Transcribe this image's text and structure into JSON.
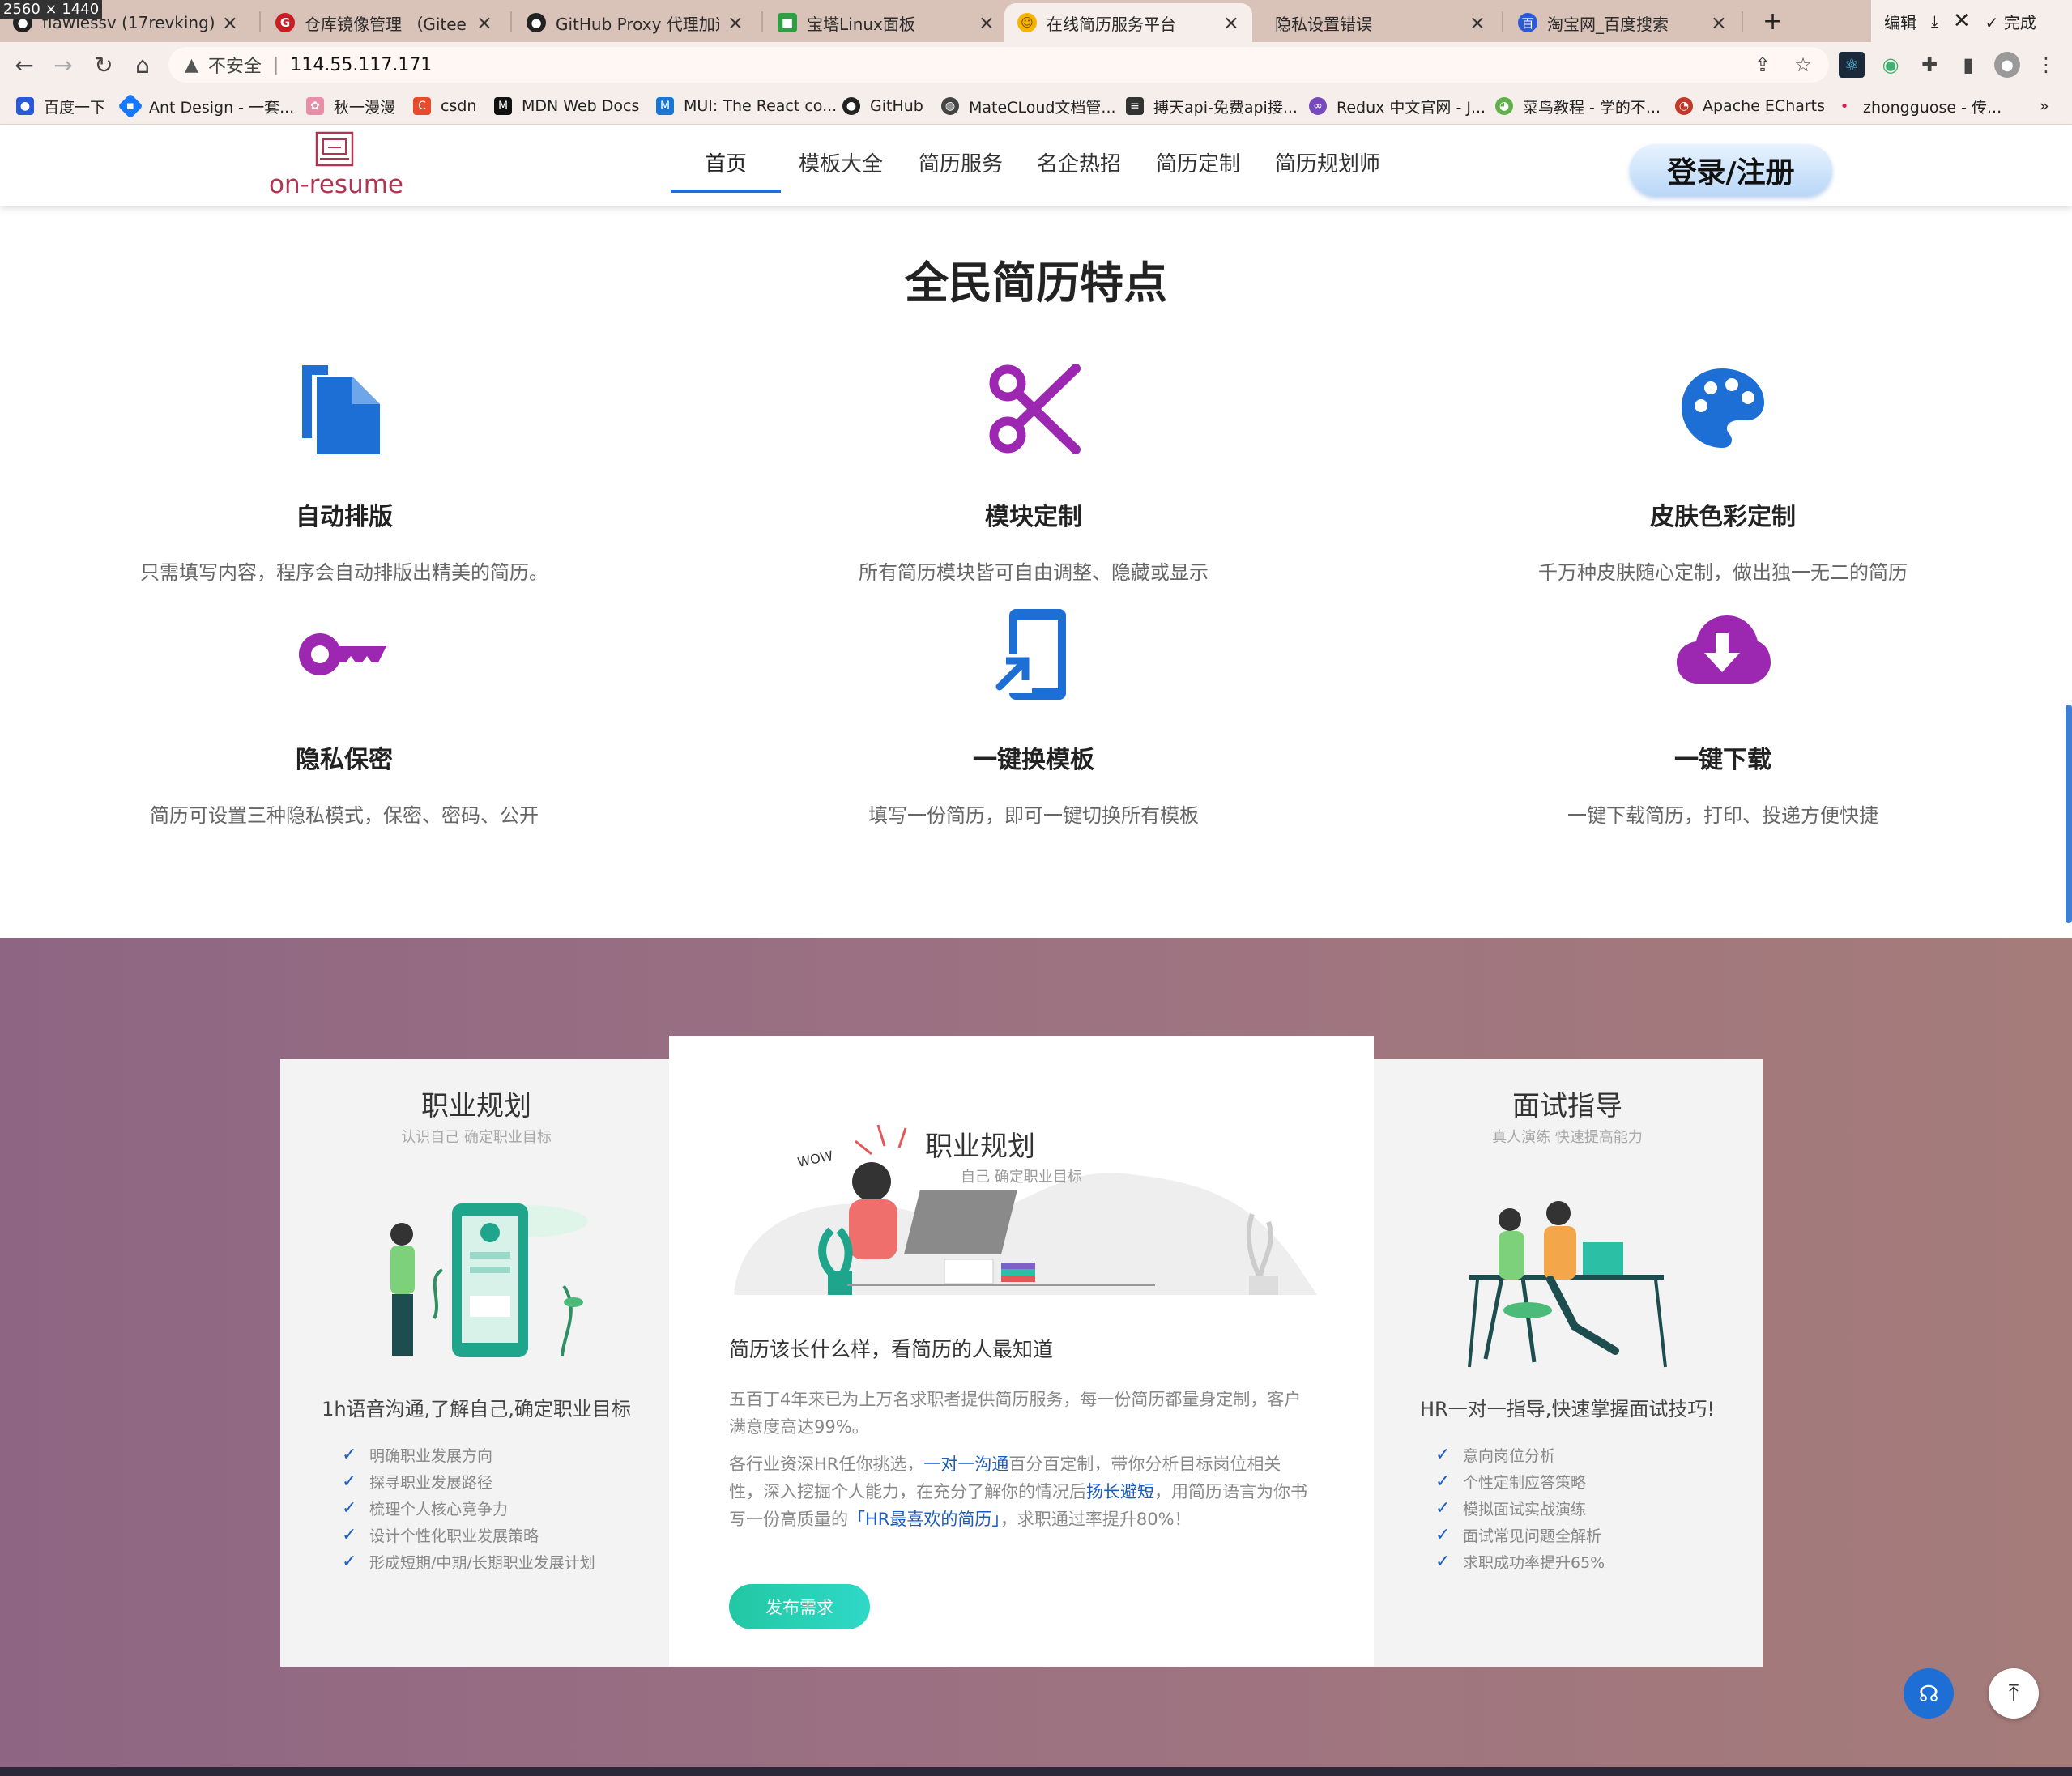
{
  "resolution_badge": "2560 × 1440",
  "browser": {
    "tabs": [
      {
        "title": "flawlessv (17revking)",
        "icon": "github-icon"
      },
      {
        "title": "仓库镜像管理 （Gitee <",
        "icon": "gitee-icon"
      },
      {
        "title": "GitHub Proxy 代理加速",
        "icon": "github-icon"
      },
      {
        "title": "宝塔Linux面板",
        "icon": "bt-shield-icon"
      },
      {
        "title": "在线简历服务平台",
        "icon": "smiley-icon",
        "active": true
      },
      {
        "title": "隐私设置错误",
        "icon": "none"
      },
      {
        "title": "淘宝网_百度搜索",
        "icon": "baidu-icon"
      }
    ],
    "new_tab": "+",
    "window_controls": {
      "edit": "编辑",
      "done": "完成"
    },
    "address": {
      "insecure_label": "不安全",
      "url": "114.55.117.171"
    },
    "bookmarks": [
      {
        "label": "百度一下",
        "icon": "baidu-paw-icon",
        "color": "#2a5ad8"
      },
      {
        "label": "Ant Design - 一套...",
        "icon": "antd-icon",
        "color": "#1677ff"
      },
      {
        "label": "秋一漫漫",
        "icon": "flower-icon",
        "color": "#e68fa8"
      },
      {
        "label": "csdn",
        "icon": "csdn-icon",
        "color": "#e84a2a"
      },
      {
        "label": "MDN Web Docs",
        "icon": "mdn-icon",
        "color": "#111111"
      },
      {
        "label": "MUI: The React co...",
        "icon": "mui-icon",
        "color": "#1976d2"
      },
      {
        "label": "GitHub",
        "icon": "github-icon",
        "color": "#222222"
      },
      {
        "label": "MateCLoud文档管...",
        "icon": "globe-icon",
        "color": "#444444"
      },
      {
        "label": "搏天api-免费api接...",
        "icon": "api-icon",
        "color": "#333333"
      },
      {
        "label": "Redux 中文官网 - J...",
        "icon": "redux-icon",
        "color": "#764abc"
      },
      {
        "label": "菜鸟教程 - 学的不...",
        "icon": "runoob-icon",
        "color": "#5fb04b"
      },
      {
        "label": "Apache ECharts",
        "icon": "echarts-icon",
        "color": "#c0392b"
      },
      {
        "label": "zhongguose - 传...",
        "icon": "dot-icon",
        "color": "#d6204b"
      }
    ],
    "bookmarks_more": "»"
  },
  "site": {
    "logo_text": "on-resume",
    "nav": [
      "首页",
      "模板大全",
      "简历服务",
      "名企热招",
      "简历定制",
      "简历规划师"
    ],
    "login": "登录/注册"
  },
  "features": {
    "title": "全民简历特点",
    "items": [
      {
        "title": "自动排版",
        "desc": "只需填写内容，程序会自动排版出精美的简历。",
        "icon": "file-copy-icon",
        "color": "#1d6fd6"
      },
      {
        "title": "模块定制",
        "desc": "所有简历模块皆可自由调整、隐藏或显示",
        "icon": "scissors-icon",
        "color": "#9c27b0"
      },
      {
        "title": "皮肤色彩定制",
        "desc": "千万种皮肤随心定制，做出独一无二的简历",
        "icon": "palette-icon",
        "color": "#1d6fd6"
      },
      {
        "title": "隐私保密",
        "desc": "简历可设置三种隐私模式，保密、密码、公开",
        "icon": "key-icon",
        "color": "#9c27b0"
      },
      {
        "title": "一键换模板",
        "desc": "填写一份简历，即可一键切换所有模板",
        "icon": "phone-switch-icon",
        "color": "#1d6fd6"
      },
      {
        "title": "一键下载",
        "desc": "一键下载简历，打印、投递方便快捷",
        "icon": "cloud-download-icon",
        "color": "#9c27b0"
      }
    ]
  },
  "services": {
    "left": {
      "title": "职业规划",
      "subtitle": "认识自己 确定职业目标",
      "tagline": "1h语音沟通,了解自己,确定职业目标",
      "items": [
        "明确职业发展方向",
        "探寻职业发展路径",
        "梳理个人核心竞争力",
        "设计个性化职业发展策略",
        "形成短期/中期/长期职业发展计划"
      ]
    },
    "center": {
      "illustration_title": "职业规划",
      "illustration_subtitle": "自己  确定职业目标",
      "illustration_wow": "WOW",
      "heading": "简历该长什么样，看简历的人最知道",
      "para1": "五百丁4年来已为上万名求职者提供简历服务，每一份简历都量身定制，客户满意度高达99%。",
      "para2_a": "各行业资深HR任你挑选，",
      "para2_hl1": "一对一沟通",
      "para2_b": "百分百定制，带你分析目标岗位相关性，深入挖掘个人能力，在充分了解你的情况后",
      "para2_hl2": "扬长避短",
      "para2_c": "，用简历语言为你书写一份高质量的",
      "para2_hl3": "「HR最喜欢的简历」",
      "para2_d": "，求职通过率提升80%！",
      "button": "发布需求"
    },
    "right": {
      "title": "面试指导",
      "subtitle": "真人演练 快速提高能力",
      "tagline": "HR一对一指导,快速掌握面试技巧!",
      "items": [
        "意向岗位分析",
        "个性定制应答策略",
        "模拟面试实战演练",
        "面试常见问题全解析",
        "求职成功率提升65%"
      ]
    }
  },
  "colors": {
    "accent_blue": "#1d6fd6",
    "accent_purple": "#9c27b0",
    "link_blue": "#1b5bbd",
    "button_teal": "#22c7a3"
  }
}
